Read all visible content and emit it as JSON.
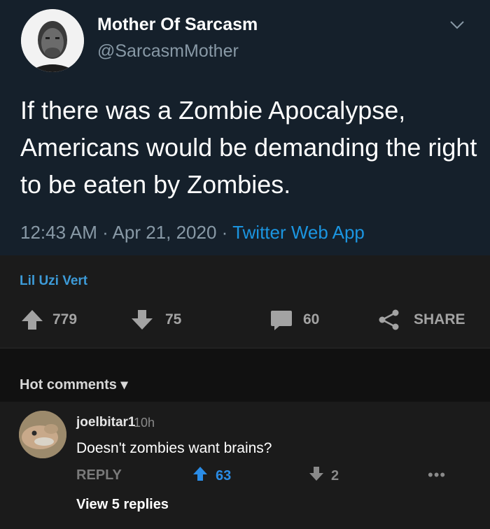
{
  "tweet": {
    "name": "Mother Of Sarcasm",
    "handle": "@SarcasmMother",
    "text": "If there was a Zombie Apocalypse, Americans would be demanding the right to be eaten by Zombies.",
    "time": "12:43 AM",
    "sep1": " · ",
    "date": "Apr 21, 2020",
    "sep2": " · ",
    "source": "Twitter Web App"
  },
  "post": {
    "author": "Lil Uzi Vert",
    "upvotes": "779",
    "downvotes": "75",
    "comments": "60",
    "share_label": "SHARE"
  },
  "hot_comments": {
    "label": "Hot comments ▾"
  },
  "comment": {
    "username": "joelbitar1",
    "time": "10h",
    "text": "Doesn't zombies want brains?",
    "reply_label": "REPLY",
    "upvotes": "63",
    "downvotes": "2",
    "more": "•••",
    "view_replies": "View 5 replies"
  },
  "colors": {
    "tweet_bg": "#15202b",
    "link_blue": "#1b95e0",
    "author_blue": "#3d9bd8",
    "upvote_blue": "#2a8ce6"
  }
}
